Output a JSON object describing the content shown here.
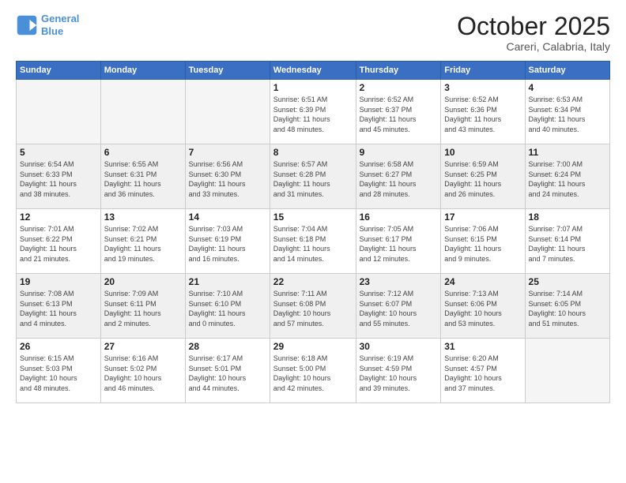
{
  "logo": {
    "line1": "General",
    "line2": "Blue"
  },
  "header": {
    "month": "October 2025",
    "location": "Careri, Calabria, Italy"
  },
  "weekdays": [
    "Sunday",
    "Monday",
    "Tuesday",
    "Wednesday",
    "Thursday",
    "Friday",
    "Saturday"
  ],
  "weeks": [
    [
      {
        "day": "",
        "info": ""
      },
      {
        "day": "",
        "info": ""
      },
      {
        "day": "",
        "info": ""
      },
      {
        "day": "1",
        "info": "Sunrise: 6:51 AM\nSunset: 6:39 PM\nDaylight: 11 hours\nand 48 minutes."
      },
      {
        "day": "2",
        "info": "Sunrise: 6:52 AM\nSunset: 6:37 PM\nDaylight: 11 hours\nand 45 minutes."
      },
      {
        "day": "3",
        "info": "Sunrise: 6:52 AM\nSunset: 6:36 PM\nDaylight: 11 hours\nand 43 minutes."
      },
      {
        "day": "4",
        "info": "Sunrise: 6:53 AM\nSunset: 6:34 PM\nDaylight: 11 hours\nand 40 minutes."
      }
    ],
    [
      {
        "day": "5",
        "info": "Sunrise: 6:54 AM\nSunset: 6:33 PM\nDaylight: 11 hours\nand 38 minutes."
      },
      {
        "day": "6",
        "info": "Sunrise: 6:55 AM\nSunset: 6:31 PM\nDaylight: 11 hours\nand 36 minutes."
      },
      {
        "day": "7",
        "info": "Sunrise: 6:56 AM\nSunset: 6:30 PM\nDaylight: 11 hours\nand 33 minutes."
      },
      {
        "day": "8",
        "info": "Sunrise: 6:57 AM\nSunset: 6:28 PM\nDaylight: 11 hours\nand 31 minutes."
      },
      {
        "day": "9",
        "info": "Sunrise: 6:58 AM\nSunset: 6:27 PM\nDaylight: 11 hours\nand 28 minutes."
      },
      {
        "day": "10",
        "info": "Sunrise: 6:59 AM\nSunset: 6:25 PM\nDaylight: 11 hours\nand 26 minutes."
      },
      {
        "day": "11",
        "info": "Sunrise: 7:00 AM\nSunset: 6:24 PM\nDaylight: 11 hours\nand 24 minutes."
      }
    ],
    [
      {
        "day": "12",
        "info": "Sunrise: 7:01 AM\nSunset: 6:22 PM\nDaylight: 11 hours\nand 21 minutes."
      },
      {
        "day": "13",
        "info": "Sunrise: 7:02 AM\nSunset: 6:21 PM\nDaylight: 11 hours\nand 19 minutes."
      },
      {
        "day": "14",
        "info": "Sunrise: 7:03 AM\nSunset: 6:19 PM\nDaylight: 11 hours\nand 16 minutes."
      },
      {
        "day": "15",
        "info": "Sunrise: 7:04 AM\nSunset: 6:18 PM\nDaylight: 11 hours\nand 14 minutes."
      },
      {
        "day": "16",
        "info": "Sunrise: 7:05 AM\nSunset: 6:17 PM\nDaylight: 11 hours\nand 12 minutes."
      },
      {
        "day": "17",
        "info": "Sunrise: 7:06 AM\nSunset: 6:15 PM\nDaylight: 11 hours\nand 9 minutes."
      },
      {
        "day": "18",
        "info": "Sunrise: 7:07 AM\nSunset: 6:14 PM\nDaylight: 11 hours\nand 7 minutes."
      }
    ],
    [
      {
        "day": "19",
        "info": "Sunrise: 7:08 AM\nSunset: 6:13 PM\nDaylight: 11 hours\nand 4 minutes."
      },
      {
        "day": "20",
        "info": "Sunrise: 7:09 AM\nSunset: 6:11 PM\nDaylight: 11 hours\nand 2 minutes."
      },
      {
        "day": "21",
        "info": "Sunrise: 7:10 AM\nSunset: 6:10 PM\nDaylight: 11 hours\nand 0 minutes."
      },
      {
        "day": "22",
        "info": "Sunrise: 7:11 AM\nSunset: 6:08 PM\nDaylight: 10 hours\nand 57 minutes."
      },
      {
        "day": "23",
        "info": "Sunrise: 7:12 AM\nSunset: 6:07 PM\nDaylight: 10 hours\nand 55 minutes."
      },
      {
        "day": "24",
        "info": "Sunrise: 7:13 AM\nSunset: 6:06 PM\nDaylight: 10 hours\nand 53 minutes."
      },
      {
        "day": "25",
        "info": "Sunrise: 7:14 AM\nSunset: 6:05 PM\nDaylight: 10 hours\nand 51 minutes."
      }
    ],
    [
      {
        "day": "26",
        "info": "Sunrise: 6:15 AM\nSunset: 5:03 PM\nDaylight: 10 hours\nand 48 minutes."
      },
      {
        "day": "27",
        "info": "Sunrise: 6:16 AM\nSunset: 5:02 PM\nDaylight: 10 hours\nand 46 minutes."
      },
      {
        "day": "28",
        "info": "Sunrise: 6:17 AM\nSunset: 5:01 PM\nDaylight: 10 hours\nand 44 minutes."
      },
      {
        "day": "29",
        "info": "Sunrise: 6:18 AM\nSunset: 5:00 PM\nDaylight: 10 hours\nand 42 minutes."
      },
      {
        "day": "30",
        "info": "Sunrise: 6:19 AM\nSunset: 4:59 PM\nDaylight: 10 hours\nand 39 minutes."
      },
      {
        "day": "31",
        "info": "Sunrise: 6:20 AM\nSunset: 4:57 PM\nDaylight: 10 hours\nand 37 minutes."
      },
      {
        "day": "",
        "info": ""
      }
    ]
  ]
}
